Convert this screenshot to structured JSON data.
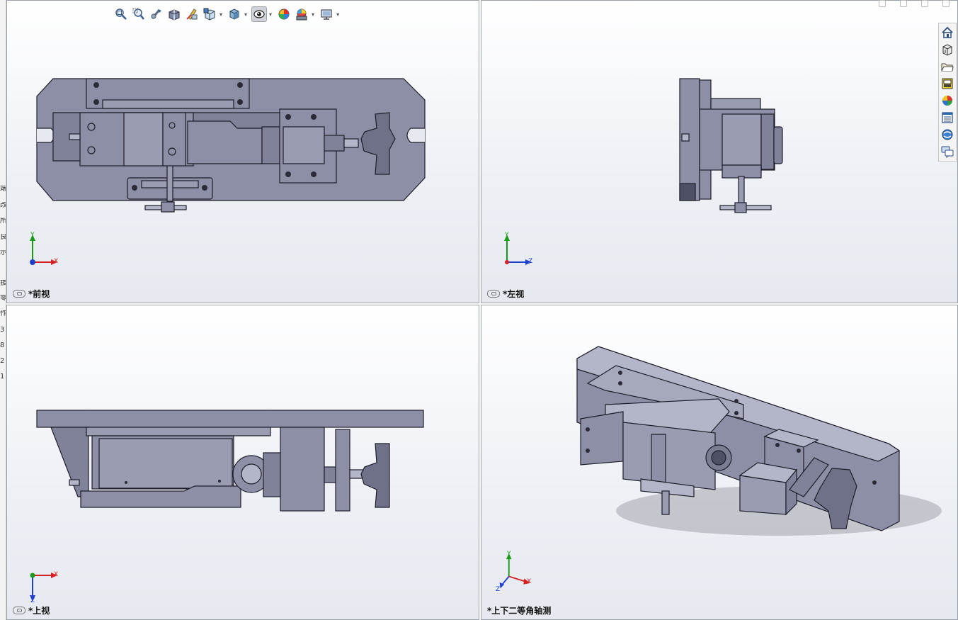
{
  "left_strip_chars": [
    "端",
    "改",
    "所",
    "良",
    "示",
    "",
    "拔",
    "零",
    "作",
    "3",
    "8",
    "2",
    "1"
  ],
  "toolbar": {
    "items": [
      {
        "icon": "zoom-to-fit-icon"
      },
      {
        "icon": "zoom-to-area-icon"
      },
      {
        "icon": "previous-view-icon"
      },
      {
        "icon": "section-view-icon"
      },
      {
        "icon": "dynamic-annotation-icon"
      },
      {
        "icon": "view-orientation-icon"
      },
      {
        "icon": "display-style-icon"
      },
      {
        "icon": "hide-show-items-icon"
      },
      {
        "icon": "edit-appearance-icon"
      },
      {
        "icon": "apply-scene-icon"
      },
      {
        "icon": "view-settings-icon"
      }
    ]
  },
  "viewports": {
    "front": {
      "label": "*前视",
      "triad_axes": [
        "Y",
        "X"
      ]
    },
    "left": {
      "label": "*左视",
      "triad_axes": [
        "Y",
        "Z"
      ]
    },
    "top": {
      "label": "*上视",
      "triad_axes": [
        "X",
        "Z"
      ]
    },
    "iso": {
      "label": "*上下二等角轴测",
      "triad_axes": [
        "Y",
        "X",
        "Z"
      ]
    }
  },
  "task_pane": {
    "items": [
      {
        "icon": "home-icon"
      },
      {
        "icon": "design-library-icon"
      },
      {
        "icon": "file-explorer-icon"
      },
      {
        "icon": "view-palette-icon"
      },
      {
        "icon": "appearances-icon"
      },
      {
        "icon": "custom-properties-icon"
      },
      {
        "icon": "solidworks-resources-icon"
      },
      {
        "icon": "forum-icon"
      }
    ]
  },
  "colors": {
    "part_fill": "#8d8fa6",
    "part_dark": "#5f6178",
    "part_light": "#b3b5c8",
    "edge": "#1d1d2a",
    "axis_x": "#d42020",
    "axis_y": "#1a9a1a",
    "axis_z": "#2040d0"
  }
}
